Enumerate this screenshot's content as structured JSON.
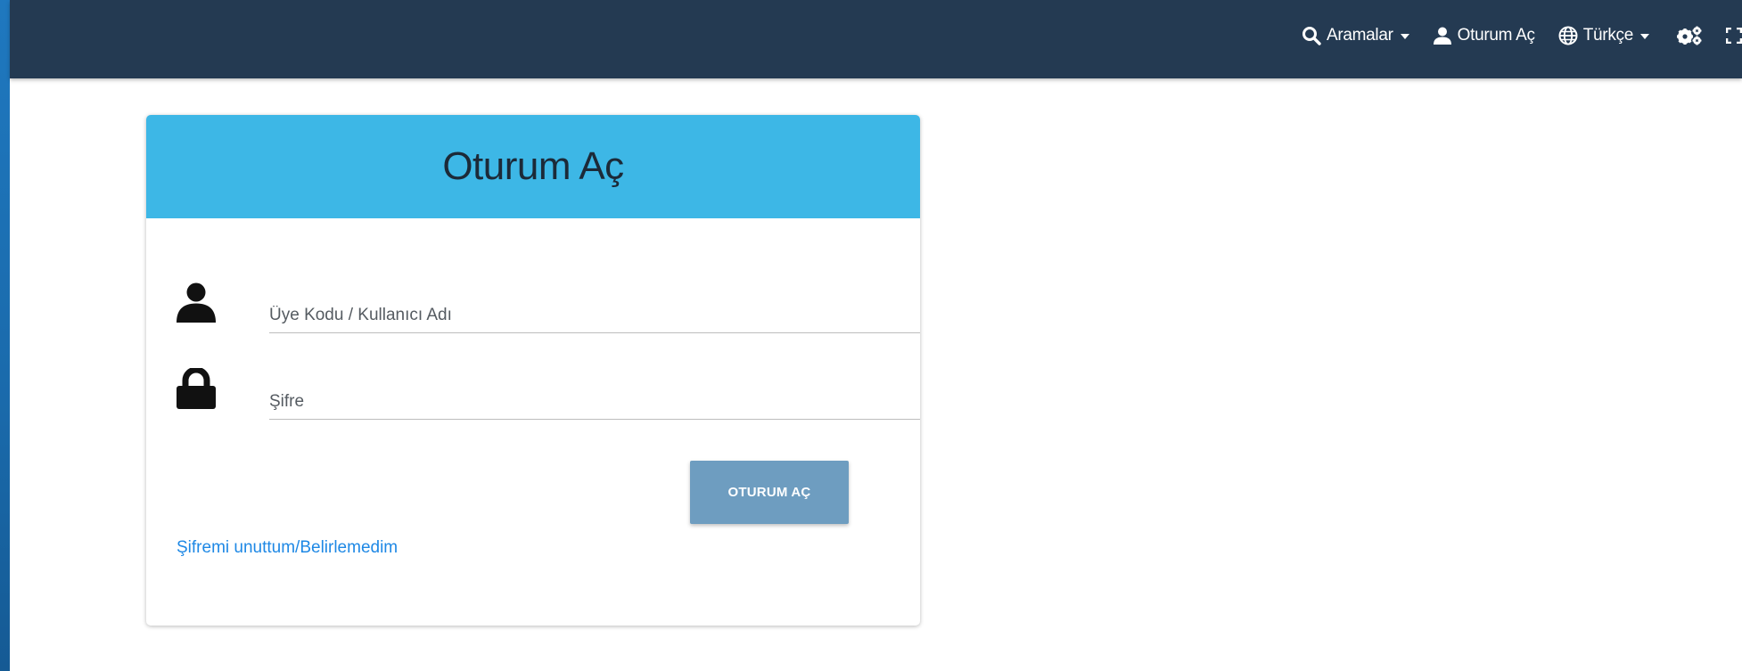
{
  "navbar": {
    "search_label": "Aramalar",
    "login_label": "Oturum Aç",
    "language_label": "Türkçe",
    "icons": {
      "search": "search-icon",
      "user": "user-icon",
      "globe": "globe-icon",
      "settings": "cogs-icon",
      "fullscreen": "fullscreen-icon"
    },
    "colors": {
      "background": "#243a52",
      "text": "#ffffff"
    }
  },
  "login_card": {
    "title": "Oturum Aç",
    "username_placeholder": "Üye Kodu / Kullanıcı Adı",
    "username_value": "",
    "password_placeholder": "Şifre",
    "password_value": "",
    "submit_label": "OTURUM AÇ",
    "forgot_link": "Şifremi unuttum/Belirlemedim",
    "icons": {
      "username": "user-icon",
      "password": "lock-icon"
    },
    "colors": {
      "header": "#3db7e6",
      "button": "#6e9dc0",
      "link": "#1e88e5"
    }
  }
}
